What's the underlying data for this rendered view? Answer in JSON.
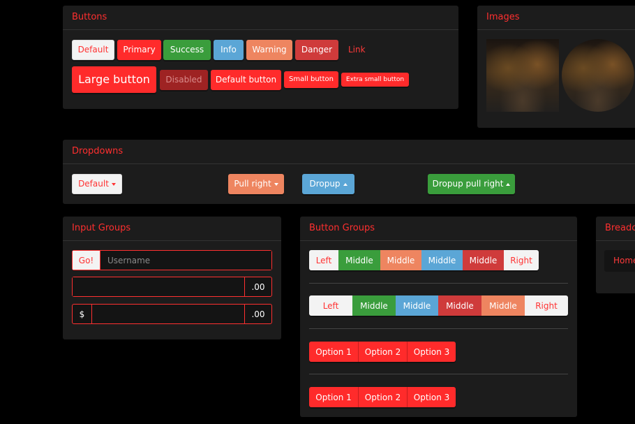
{
  "panels": {
    "buttons": "Buttons",
    "images": "Images",
    "dropdowns": "Dropdowns",
    "input_groups": "Input Groups",
    "button_groups": "Button Groups",
    "breadcrumbs": "Breadcr"
  },
  "buttons": {
    "default": "Default",
    "primary": "Primary",
    "success": "Success",
    "info": "Info",
    "warning": "Warning",
    "danger": "Danger",
    "link": "Link",
    "large": "Large button",
    "disabled": "Disabled",
    "default_button": "Default button",
    "small": "Small button",
    "extra_small": "Extra small button"
  },
  "dropdowns": {
    "default": "Default",
    "pull_right": "Pull right",
    "dropup": "Dropup",
    "dropup_pull_right": "Dropup pull right"
  },
  "input_groups": {
    "go_button": "Go!",
    "username_placeholder": "Username",
    "cents_addon_1": ".00",
    "dollar_addon": "$",
    "cents_addon_2": ".00"
  },
  "button_groups": {
    "row1": [
      "Left",
      "Middle",
      "Middle",
      "Middle",
      "Middle",
      "Right"
    ],
    "row2": [
      "Left",
      "Middle",
      "Middle",
      "Middle",
      "Middle",
      "Right"
    ],
    "row3": [
      "Option 1",
      "Option 2",
      "Option 3"
    ],
    "row4": [
      "Option 1",
      "Option 2",
      "Option 3"
    ]
  },
  "breadcrumbs": {
    "home": "Home"
  }
}
